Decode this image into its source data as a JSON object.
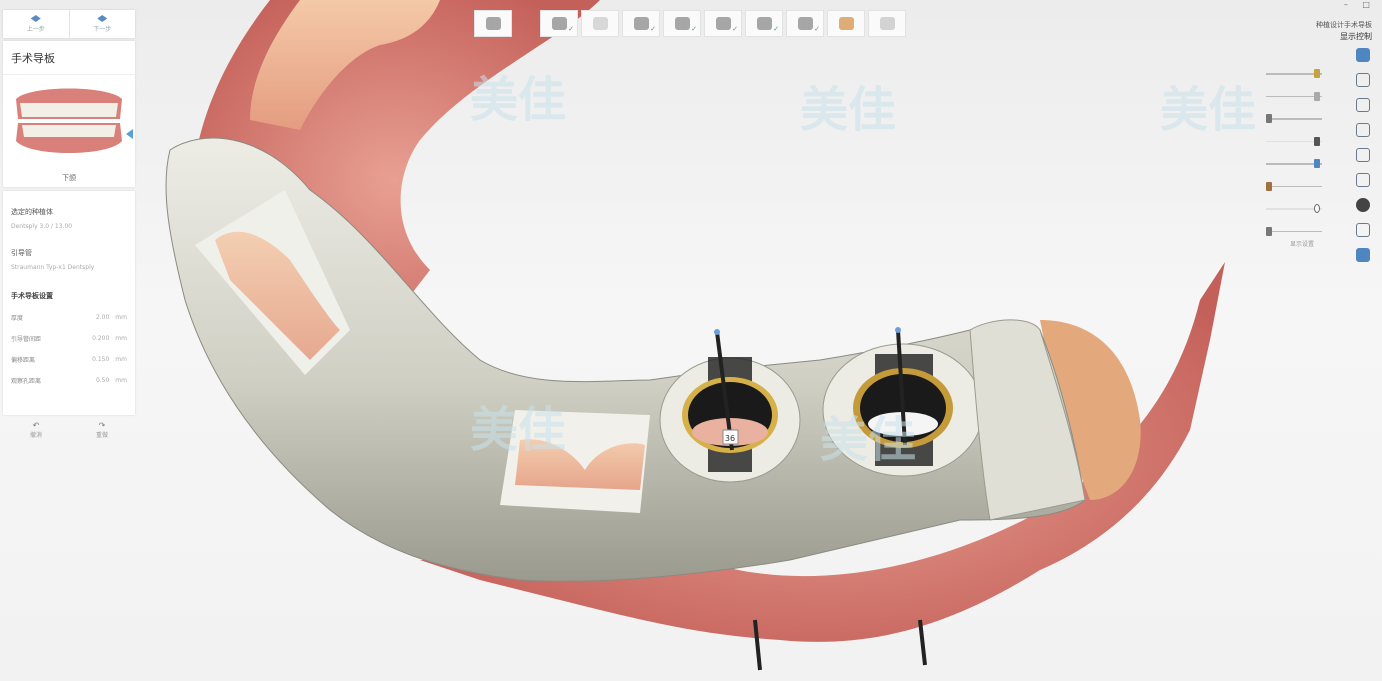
{
  "nav": {
    "prev_label": "上一步",
    "next_label": "下一步"
  },
  "panel": {
    "title": "手术导板",
    "model_label": "下颌"
  },
  "info": {
    "implant_label": "选定的种植体",
    "implant_value": "Dentsply 3.0 / 13.00",
    "sleeve_label": "引导管",
    "sleeve_value": "Straumann Typ-x1 Dentsply",
    "params_heading": "手术导板设置",
    "params": [
      {
        "label": "厚度",
        "value": "2.00",
        "unit": "mm"
      },
      {
        "label": "引导管间距",
        "value": "0.200",
        "unit": "mm"
      },
      {
        "label": "偏移距离",
        "value": "0.150",
        "unit": "mm"
      },
      {
        "label": "观察孔距离",
        "value": "0.50",
        "unit": "mm"
      }
    ]
  },
  "bottom": {
    "btn1": "撤消",
    "btn2": "重做"
  },
  "right": {
    "title_line1": "种植设计手术导板",
    "title_line2": "显示控制"
  },
  "window": {
    "controls": "– □"
  },
  "slider_footer": "显示设置",
  "annotation": {
    "tooth_number": "36"
  },
  "watermark": "美佳",
  "colors": {
    "guide_body": "#d9d9cf",
    "gum": "#d07070",
    "sleeve_ring": "#d6b14a",
    "accent_blue": "#4f86c0"
  }
}
